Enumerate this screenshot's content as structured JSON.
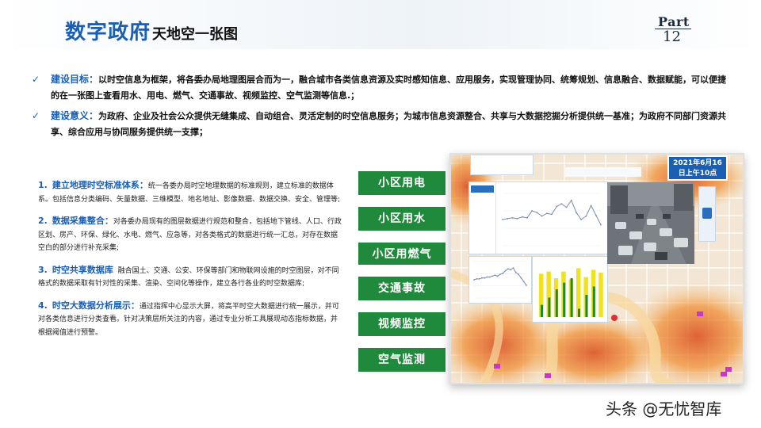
{
  "header": {
    "title_main": "数字政府",
    "title_sub": "天地空一张图",
    "part_label": "Part",
    "part_number": "12"
  },
  "bullets": [
    {
      "key": "建设目标：",
      "text": "以时空信息为框架，将各委办局地理图层合而为一，融合城市各类信息资源及实时感知信息、应用服务，实现管理协同、统筹规划、信息融合、数据赋能，可以便捷的在一张图上查看用水、用电、燃气、交通事故、视频监控、空气监测等信息.；"
    },
    {
      "key": "建设意义：",
      "text": "为政府、企业及社会公众提供无缝集成、自动组合、灵活定制的时空信息服务；为城市信息资源整合、共享与大数据挖掘分析提供统一基准；为政府不同部门资源共享、综合应用与协同服务提供统一支撑；"
    }
  ],
  "items": [
    {
      "num": "1.",
      "head": "建立地理时空标准体系：",
      "text": "统一各委办局时空地理数据的标准规则，建立标准的数据体系。包括信息分类编码、矢量数据、三维模型、地名地址、影像数据、数据交换、安全、管理等;"
    },
    {
      "num": "2.",
      "head": "数据采集整合：",
      "text": "对各委办局现有的图层数据进行规范和整合，包括地下管线、人口、行政区划、房产、环保、绿化、水电、燃气、应急等，对各类格式的数据进行统一汇总，对存在数据空白的部分进行补充采集;"
    },
    {
      "num": "3.",
      "head": "时空共享数据库",
      "text": "融合国土、交通、公安、环保等部门和物联网设施的时空图层，对不同格式的数据采取有针对性的采集、渲染、空间化等操作，建立各行各业的时空数据库;"
    },
    {
      "num": "4.",
      "head": "时空大数据分析展示：",
      "text": "通过指挥中心显示大屏，将高平时空大数据进行统一展示，并可对各类信息进行分类查看。针对决策层所关注的内容，通过专业分析工具展现动态指标数据，并根据阈值进行预警。"
    }
  ],
  "tags": [
    "小区用电",
    "小区用水",
    "小区用燃气",
    "交通事故",
    "视频监控",
    "空气监测"
  ],
  "date_badge": {
    "line1": "2021年6月16",
    "line2": "日上午10点"
  },
  "watermark": "头条 @无忧智库",
  "colors": {
    "accent": "#1a5fb4",
    "tag_green": "#1f8a3b",
    "bar_yellow": "#f2e21b",
    "bar_green": "#1e8a2e"
  },
  "chart_data": [
    {
      "type": "line",
      "values": [
        30,
        31,
        32,
        31,
        33,
        32,
        40,
        38,
        34,
        37,
        36,
        45,
        48,
        44,
        52,
        38,
        30,
        34,
        46,
        35,
        24
      ]
    },
    {
      "type": "line",
      "values": [
        20,
        21,
        21,
        22,
        22,
        23,
        23,
        24,
        25,
        24,
        26,
        27,
        30,
        32,
        31,
        33,
        28,
        26,
        22,
        18,
        14
      ]
    },
    {
      "type": "bar",
      "values": [
        78,
        82,
        70,
        82,
        68,
        88,
        72,
        85,
        80
      ]
    },
    {
      "type": "bar",
      "values": [
        22,
        35,
        50,
        62,
        70,
        15,
        40,
        55
      ]
    }
  ]
}
